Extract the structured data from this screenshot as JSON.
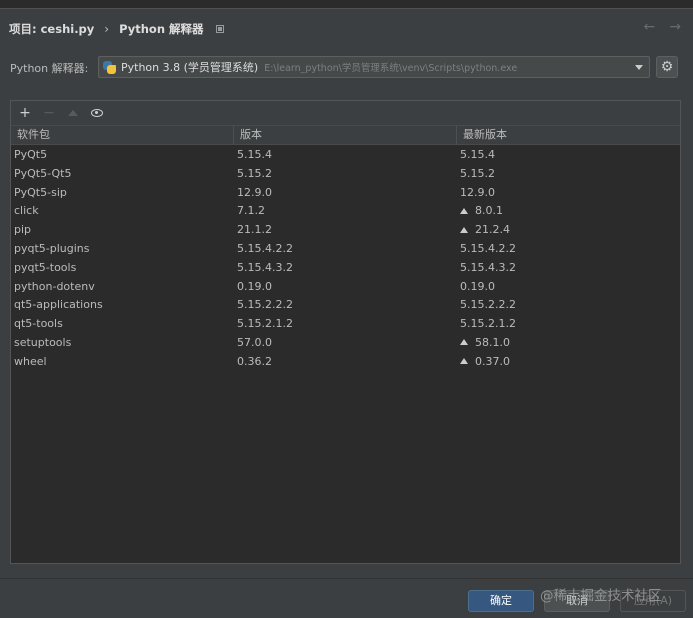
{
  "breadcrumb": {
    "project": "项目: ceshi.py",
    "separator": "›",
    "page": "Python 解释器",
    "back_icon": "←",
    "forward_icon": "→"
  },
  "interpreter": {
    "label": "Python 解释器:",
    "name": "Python 3.8 (学员管理系统)",
    "path": "E:\\learn_python\\学员管理系统\\venv\\Scripts\\python.exe",
    "settings_icon": "⚙"
  },
  "toolbar": {
    "add_icon": "+",
    "remove_icon": "−"
  },
  "table": {
    "headers": [
      "软件包",
      "版本",
      "最新版本"
    ],
    "rows": [
      {
        "name": "PyQt5",
        "version": "5.15.4",
        "latest": "5.15.4",
        "upgrade": false
      },
      {
        "name": "PyQt5-Qt5",
        "version": "5.15.2",
        "latest": "5.15.2",
        "upgrade": false
      },
      {
        "name": "PyQt5-sip",
        "version": "12.9.0",
        "latest": "12.9.0",
        "upgrade": false
      },
      {
        "name": "click",
        "version": "7.1.2",
        "latest": "8.0.1",
        "upgrade": true
      },
      {
        "name": "pip",
        "version": "21.1.2",
        "latest": "21.2.4",
        "upgrade": true
      },
      {
        "name": "pyqt5-plugins",
        "version": "5.15.4.2.2",
        "latest": "5.15.4.2.2",
        "upgrade": false
      },
      {
        "name": "pyqt5-tools",
        "version": "5.15.4.3.2",
        "latest": "5.15.4.3.2",
        "upgrade": false
      },
      {
        "name": "python-dotenv",
        "version": "0.19.0",
        "latest": "0.19.0",
        "upgrade": false
      },
      {
        "name": "qt5-applications",
        "version": "5.15.2.2.2",
        "latest": "5.15.2.2.2",
        "upgrade": false
      },
      {
        "name": "qt5-tools",
        "version": "5.15.2.1.2",
        "latest": "5.15.2.1.2",
        "upgrade": false
      },
      {
        "name": "setuptools",
        "version": "57.0.0",
        "latest": "58.1.0",
        "upgrade": true
      },
      {
        "name": "wheel",
        "version": "0.36.2",
        "latest": "0.37.0",
        "upgrade": true
      }
    ]
  },
  "buttons": {
    "ok": "确定",
    "cancel": "取消",
    "apply": "应用(A)"
  },
  "watermark": "@稀土掘金技术社区"
}
